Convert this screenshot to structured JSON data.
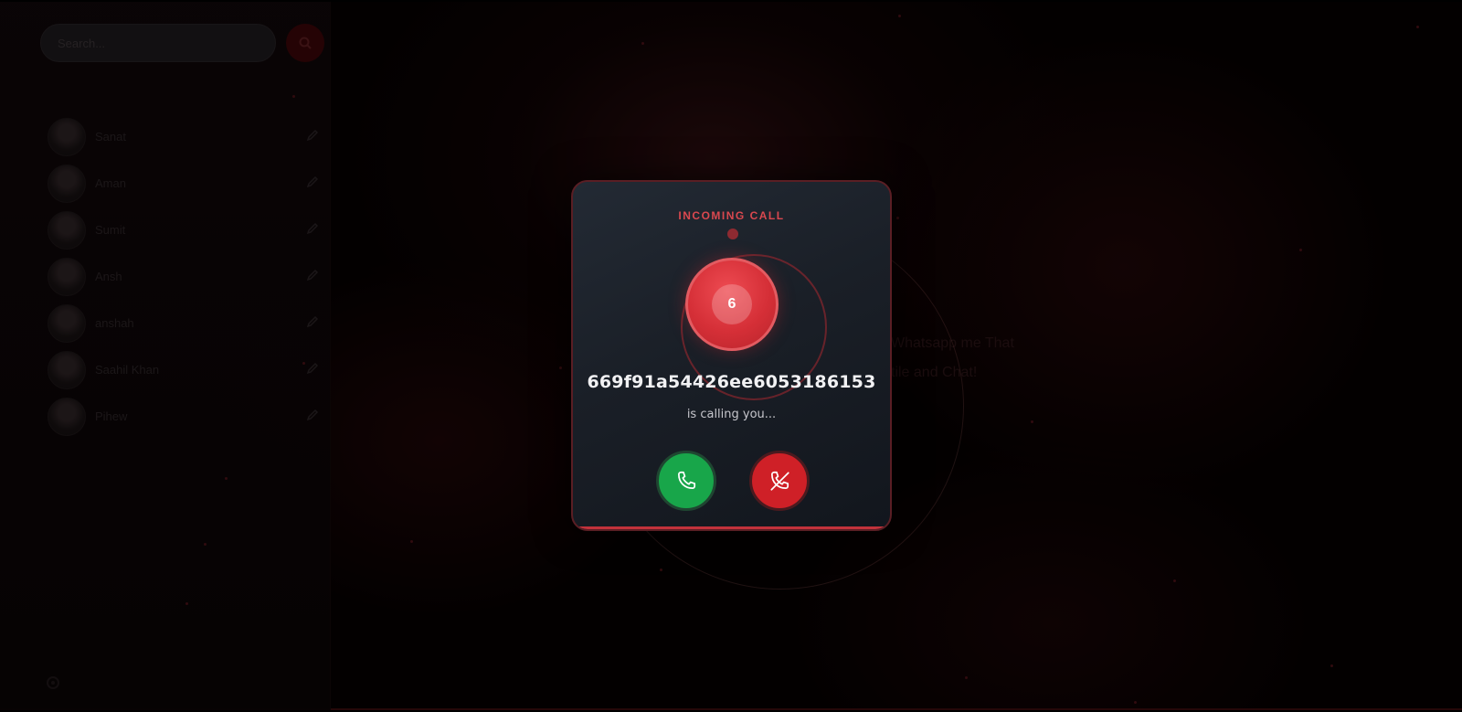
{
  "sidebar": {
    "search": {
      "placeholder": "Search..."
    },
    "contacts": [
      {
        "name": "Sanat"
      },
      {
        "name": "Aman"
      },
      {
        "name": "Sumit"
      },
      {
        "name": "Ansh"
      },
      {
        "name": "anshah"
      },
      {
        "name": "Saahil Khan"
      },
      {
        "name": "Pihew"
      }
    ]
  },
  "chat": {
    "welcome_line1": "Whatsapp me That",
    "welcome_line2": "tile and Chat!"
  },
  "incoming_call": {
    "title": "INCOMING CALL",
    "caller_initial": "6",
    "caller_id": "669f91a54426ee6053186153",
    "status": "is calling you...",
    "accept_icon": "phone-icon",
    "decline_icon": "phone-off-icon"
  },
  "colors": {
    "accent": "#d52f37",
    "accept": "#18a64a",
    "decline": "#cf2027",
    "modal_bg": "#1a1f27"
  }
}
